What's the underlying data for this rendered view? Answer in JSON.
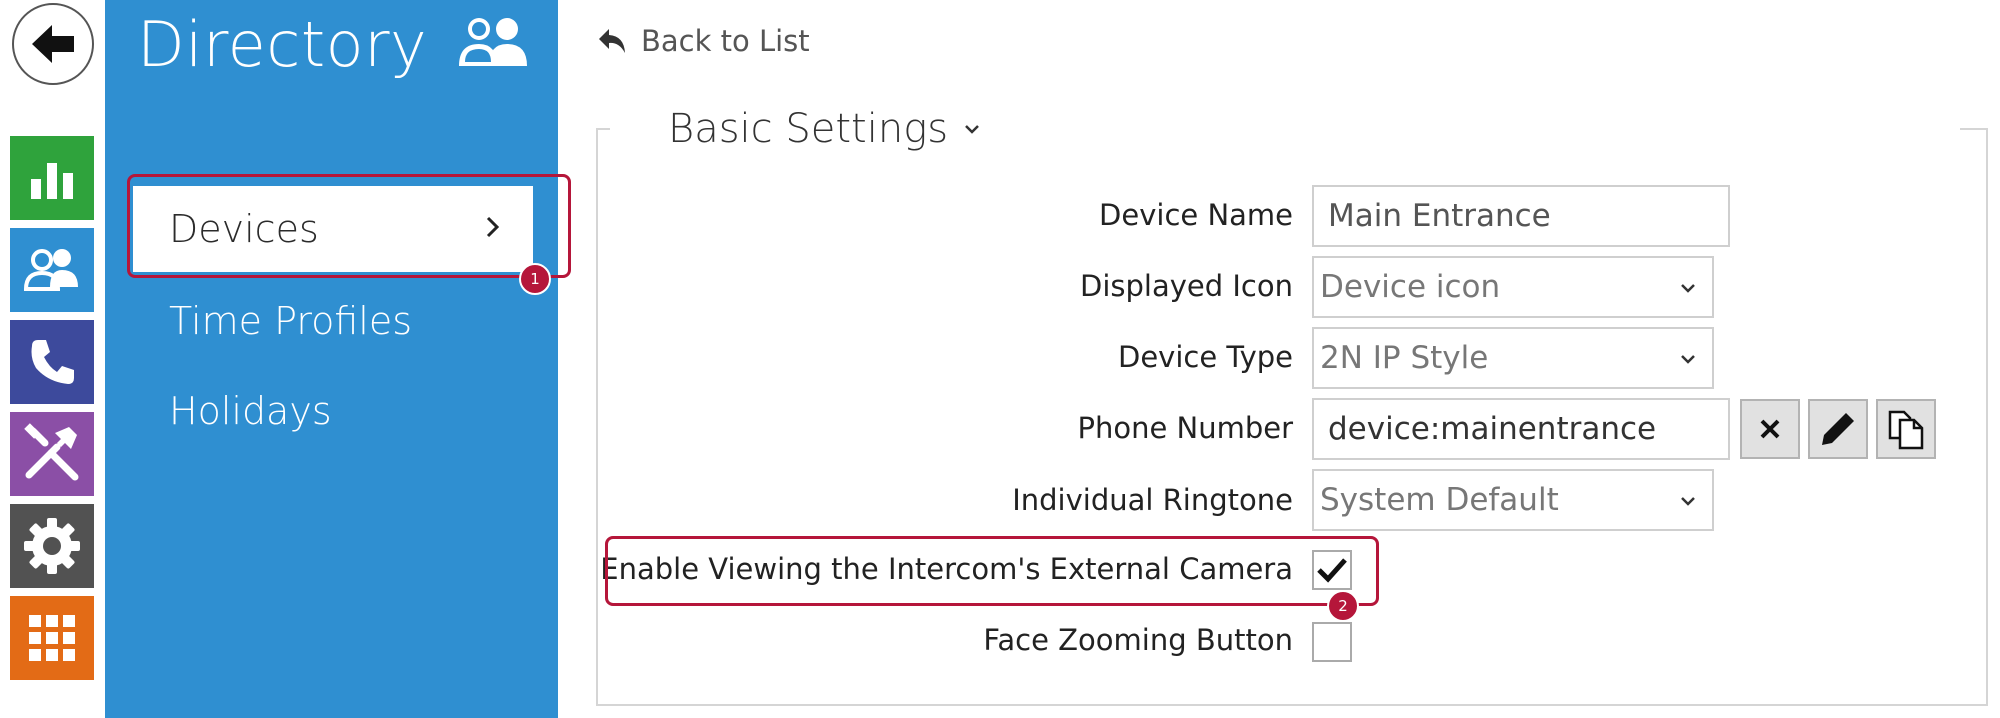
{
  "rail": {
    "items": [
      {
        "icon": "bar-chart-icon",
        "color": "#2fa33c"
      },
      {
        "icon": "users-icon",
        "color": "#2f8fd1"
      },
      {
        "icon": "phone-icon",
        "color": "#3d4a9c"
      },
      {
        "icon": "tools-icon",
        "color": "#8b4fa6"
      },
      {
        "icon": "gear-icon",
        "color": "#525252"
      },
      {
        "icon": "grid-icon",
        "color": "#e36b16"
      }
    ]
  },
  "panel": {
    "title": "Directory",
    "menu": [
      {
        "label": "Devices",
        "active": true
      },
      {
        "label": "Time Profiles",
        "active": false
      },
      {
        "label": "Holidays",
        "active": false
      }
    ]
  },
  "main": {
    "back_label": "Back to List",
    "section_title": "Basic Settings",
    "fields": {
      "device_name": {
        "label": "Device Name",
        "value": "Main Entrance"
      },
      "displayed_icon": {
        "label": "Displayed Icon",
        "value": "Device icon"
      },
      "device_type": {
        "label": "Device Type",
        "value": "2N IP Style"
      },
      "phone_number": {
        "label": "Phone Number",
        "value": "device:mainentrance"
      },
      "ringtone": {
        "label": "Individual Ringtone",
        "value": "System Default"
      },
      "external_camera": {
        "label": "Enable Viewing the Intercom's External Camera",
        "checked": true
      },
      "face_zoom": {
        "label": "Face Zooming Button",
        "checked": false
      }
    }
  },
  "annotations": {
    "badge1": "1",
    "badge2": "2"
  },
  "colors": {
    "panel_blue": "#2f8fd1",
    "annotation_red": "#b5163a"
  }
}
